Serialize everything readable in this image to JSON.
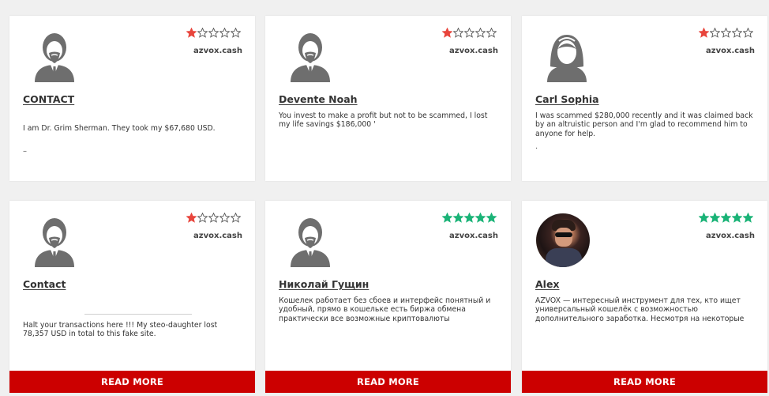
{
  "colors": {
    "page_bg": "#f0f0f0",
    "card_bg": "#ffffff",
    "star_red": "#e8453c",
    "star_green": "#1ab377",
    "star_empty": "#555555",
    "read_more_bg": "#cc0000"
  },
  "reviews": [
    {
      "name": "CONTACT",
      "source": "azvox.cash",
      "rating": 1,
      "star_color": "red",
      "avatar": "male-avatar-icon",
      "text": "I am Dr. Grim Sherman. They took my $67,680 USD.",
      "extra": "–"
    },
    {
      "name": "Devente Noah",
      "source": "azvox.cash",
      "rating": 1,
      "star_color": "red",
      "avatar": "male-avatar-icon",
      "text": "You invest to make a profit but not to be scammed, I lost my life savings $186,000 '"
    },
    {
      "name": "Carl Sophia",
      "source": "azvox.cash",
      "rating": 1,
      "star_color": "red",
      "avatar": "female-avatar-icon",
      "text": "I was scammed $280,000 recently and it was claimed back by an altruistic person and I'm glad to recommend him to anyone for help.",
      "extra": "."
    },
    {
      "name": "Contact",
      "source": "azvox.cash",
      "rating": 1,
      "star_color": "red",
      "avatar": "male-avatar-icon",
      "text": "Halt your transactions here !!! My steo-daughter lost 78,357 USD in total to this fake site.",
      "read_more": "READ MORE"
    },
    {
      "name": "Николай Гущин",
      "source": "azvox.cash",
      "rating": 5,
      "star_color": "green",
      "avatar": "male-avatar-icon",
      "text": "Кошелек работает без сбоев и интерфейс понятный и удобный, прямо в кошельке есть биржа обмена практически все возможные криптовалюты",
      "read_more": "READ MORE"
    },
    {
      "name": "Alex",
      "source": "azvox.cash",
      "rating": 5,
      "star_color": "green",
      "avatar": "user-photo",
      "text": "AZVOX — интересный инструмент для тех, кто ищет универсальный кошелёк с возможностью дополнительного заработка. Несмотря на некоторые",
      "read_more": "READ MORE"
    }
  ]
}
